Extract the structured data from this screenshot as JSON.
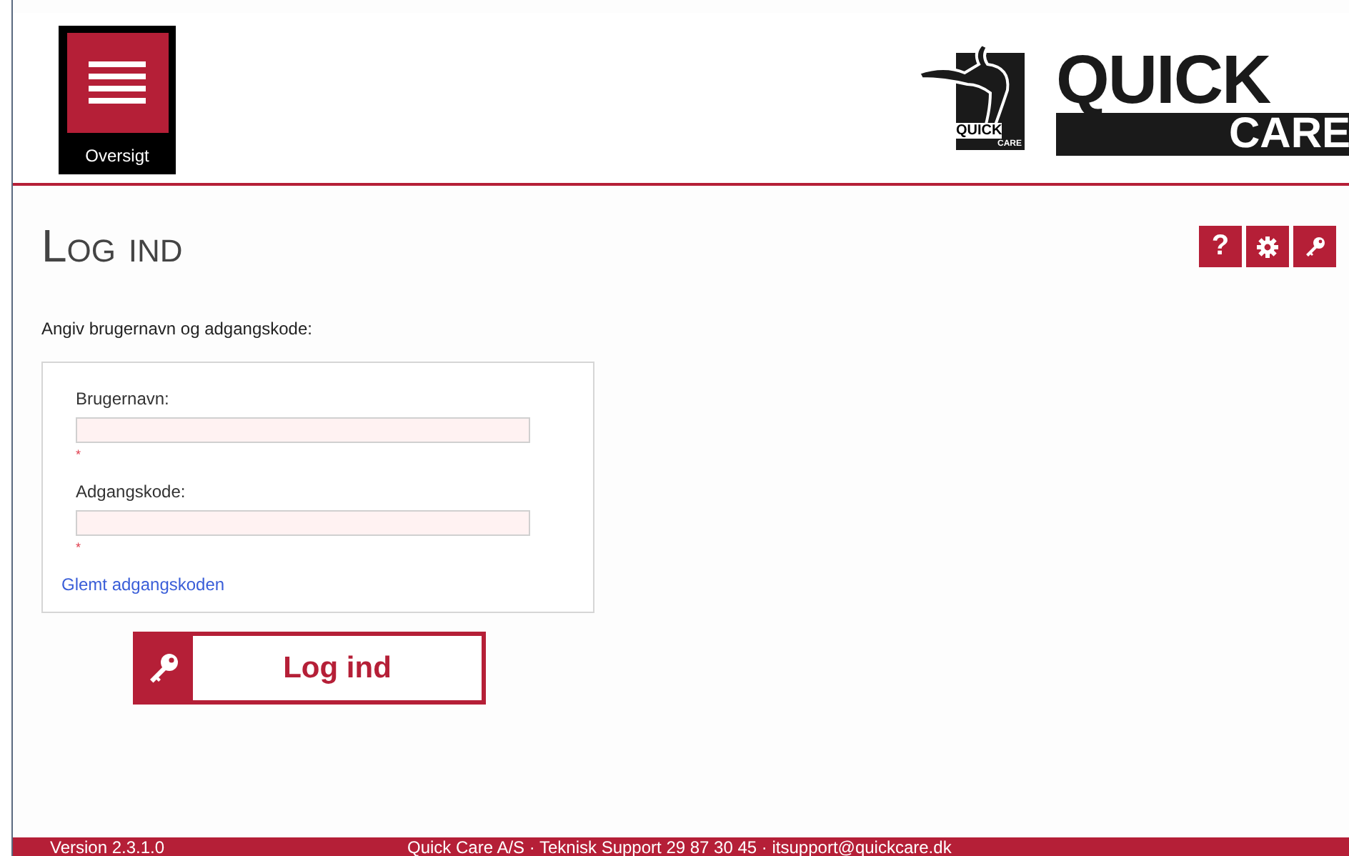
{
  "header": {
    "menu_label": "Oversigt",
    "logo": {
      "emblem_top": "QUICK",
      "emblem_bottom": "CARE",
      "word_top": "QUICK",
      "word_bottom": "CARE"
    }
  },
  "page": {
    "title": "Log ind",
    "tool_buttons": [
      {
        "kind": "help",
        "label": "?"
      },
      {
        "kind": "settings"
      },
      {
        "kind": "key"
      }
    ]
  },
  "instruction": "Angiv brugernavn og adgangskode:",
  "fields": [
    {
      "label": "Brugernavn:",
      "required_mark": "*"
    },
    {
      "label": "Adgangskode:",
      "required_mark": "*"
    }
  ],
  "forgot_link": "Glemt adgangskoden",
  "login_button": "Log ind",
  "footer": {
    "version": "Version 2.3.1.0",
    "contact": "Quick Care A/S · Teknisk Support 29 87 30 45 · itsupport@quickcare.dk"
  }
}
